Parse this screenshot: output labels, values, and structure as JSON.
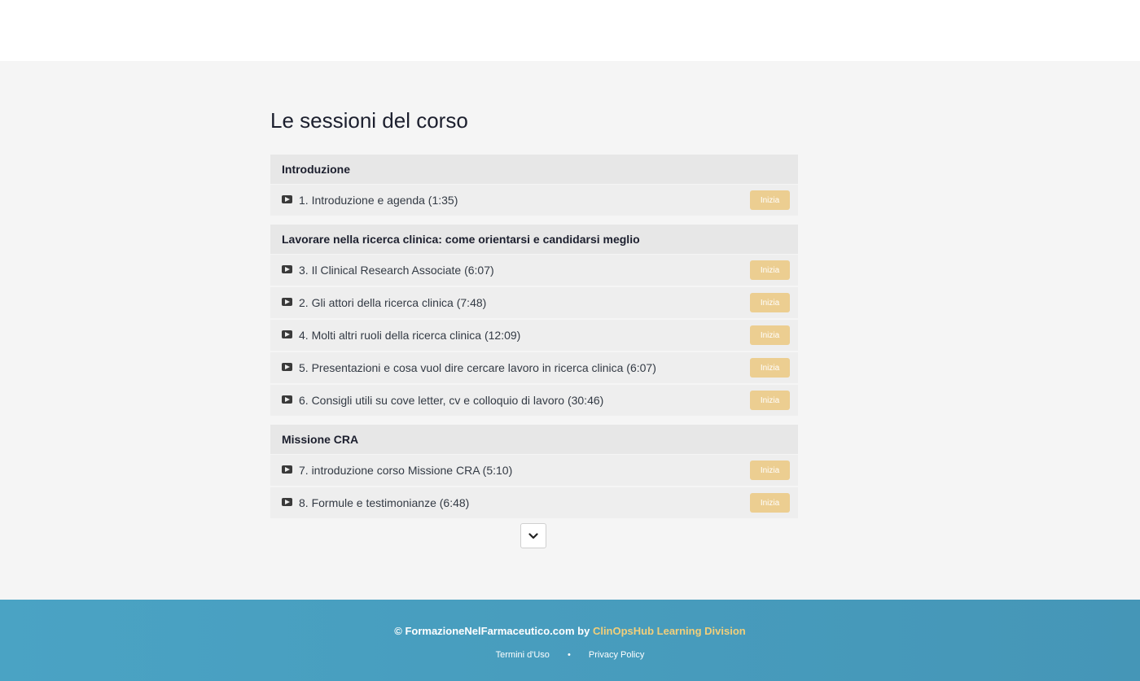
{
  "page": {
    "title": "Le sessioni del corso",
    "start_label": "Inizia",
    "more_icon": "chevron-down-icon"
  },
  "sections": [
    {
      "title": "Introduzione",
      "lectures": [
        {
          "name": "1. Introduzione e agenda (1:35)"
        }
      ]
    },
    {
      "title": "Lavorare nella ricerca clinica: come orientarsi e candidarsi meglio",
      "lectures": [
        {
          "name": "3. Il Clinical Research Associate (6:07)"
        },
        {
          "name": "2. Gli attori della ricerca clinica (7:48)"
        },
        {
          "name": "4. Molti altri ruoli della ricerca clinica (12:09)"
        },
        {
          "name": "5. Presentazioni e cosa vuol dire cercare lavoro in ricerca clinica (6:07)"
        },
        {
          "name": "6. Consigli utili su cove letter, cv e colloquio di lavoro (30:46)"
        }
      ]
    },
    {
      "title": "Missione CRA",
      "lectures": [
        {
          "name": "7. introduzione corso Missione CRA (5:10)"
        },
        {
          "name": "8. Formule e testimonianze (6:48)"
        }
      ]
    }
  ],
  "footer": {
    "copyright": "© FormazioneNelFarmaceutico.com",
    "by": "by",
    "brand": "ClinOpsHub Learning Division",
    "links": [
      "Termini d'Uso",
      "Privacy Policy"
    ],
    "separator": "•"
  },
  "colors": {
    "accent": "#ecce91",
    "footer_bg": "#4aa3c4",
    "brand": "#f2cf7a"
  }
}
